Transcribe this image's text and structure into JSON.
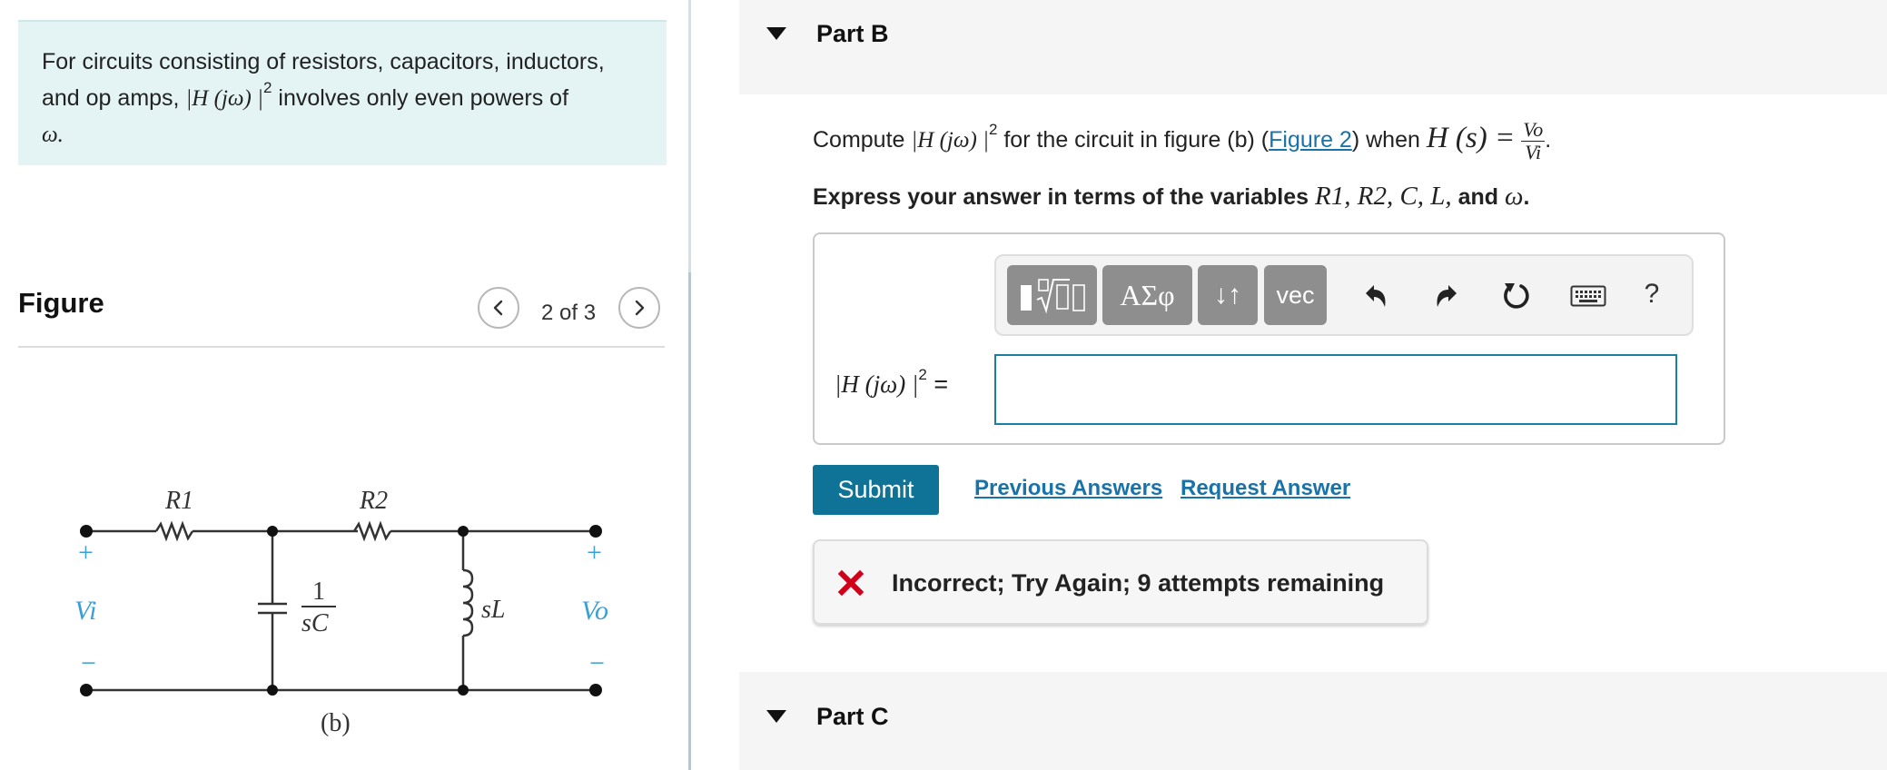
{
  "hint": {
    "line1": "For circuits consisting of resistors, capacitors, inductors,",
    "line2_pre": "and op amps, ",
    "line2_math": "|H (jω) |",
    "line2_sup": "2",
    "line2_post": " involves only even powers of",
    "line3": "ω."
  },
  "figure": {
    "title": "Figure",
    "counter": "2 of 3",
    "prev_icon": "chevron-left-icon",
    "next_icon": "chevron-right-icon",
    "labels": {
      "r1": "R1",
      "r2": "R2",
      "cap_num": "1",
      "cap_den": "sC",
      "inductor": "sL",
      "vi": "Vi",
      "vo": "Vo",
      "plus": "+",
      "minus": "−",
      "caption": "(b)"
    }
  },
  "part_b": {
    "title": "Part B",
    "question": {
      "pre": "Compute ",
      "expr": "|H (jω) |",
      "expr_sup": "2",
      "mid": " for the circuit in figure (b) (",
      "link": "Figure 2",
      "post": ") when ",
      "hs": "H (s) =",
      "frac_num": "Vo",
      "frac_den": "Vi",
      "end": "."
    },
    "instructions": {
      "pre": "Express your answer in terms of the variables ",
      "vars": "R1, R2, C, L,",
      "and": " and ",
      "omega": "ω",
      "end": "."
    },
    "toolbar": {
      "template_icon": "fraction-root-template-icon",
      "greek": "ΑΣφ",
      "updown": "↓↑",
      "vec": "vec",
      "undo_icon": "undo-icon",
      "redo_icon": "redo-icon",
      "reset_icon": "reset-icon",
      "keyboard_icon": "keyboard-icon",
      "help": "?"
    },
    "answer": {
      "label": "|H (jω) |",
      "label_sup": "2",
      "equals": " =",
      "value": "",
      "placeholder": ""
    },
    "submit": "Submit",
    "previous_answers": "Previous Answers",
    "request_answer": "Request Answer",
    "feedback": "Incorrect; Try Again; 9 attempts remaining"
  },
  "part_c": {
    "title": "Part C"
  },
  "colors": {
    "hint_bg": "#e4f4f5",
    "accent": "#0e7397",
    "link": "#1a73a8",
    "error": "#d0021b",
    "circuit_label": "#3a9fd6"
  }
}
